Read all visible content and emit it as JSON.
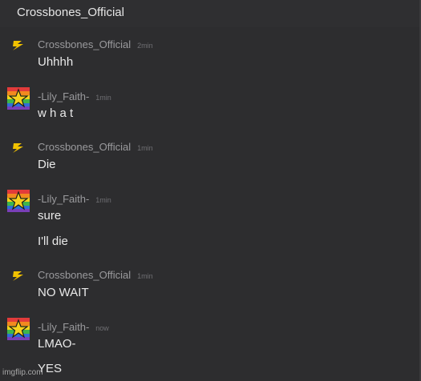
{
  "header": {
    "title": "Crossbones_Official"
  },
  "messages": [
    {
      "user": "Crossbones_Official",
      "time": "2min",
      "avatar": "lightning-bolt-icon",
      "lines": [
        "Uhhhh"
      ]
    },
    {
      "user": "-Lily_Faith-",
      "time": "1min",
      "avatar": "rainbow-star-avatar",
      "lines": [
        "w h a t"
      ]
    },
    {
      "user": "Crossbones_Official",
      "time": "1min",
      "avatar": "lightning-bolt-icon",
      "lines": [
        "Die"
      ]
    },
    {
      "user": "-Lily_Faith-",
      "time": "1min",
      "avatar": "rainbow-star-avatar",
      "lines": [
        "sure",
        "I'll die"
      ]
    },
    {
      "user": "Crossbones_Official",
      "time": "1min",
      "avatar": "lightning-bolt-icon",
      "lines": [
        "NO WAIT"
      ]
    },
    {
      "user": "-Lily_Faith-",
      "time": "now",
      "avatar": "rainbow-star-avatar",
      "lines": [
        "LMAO-",
        "YES"
      ]
    }
  ],
  "watermark": "imgflip.com",
  "colors": {
    "background": "#2d2d2f",
    "bolt": "#f2c200",
    "star": "#f7d21d"
  }
}
